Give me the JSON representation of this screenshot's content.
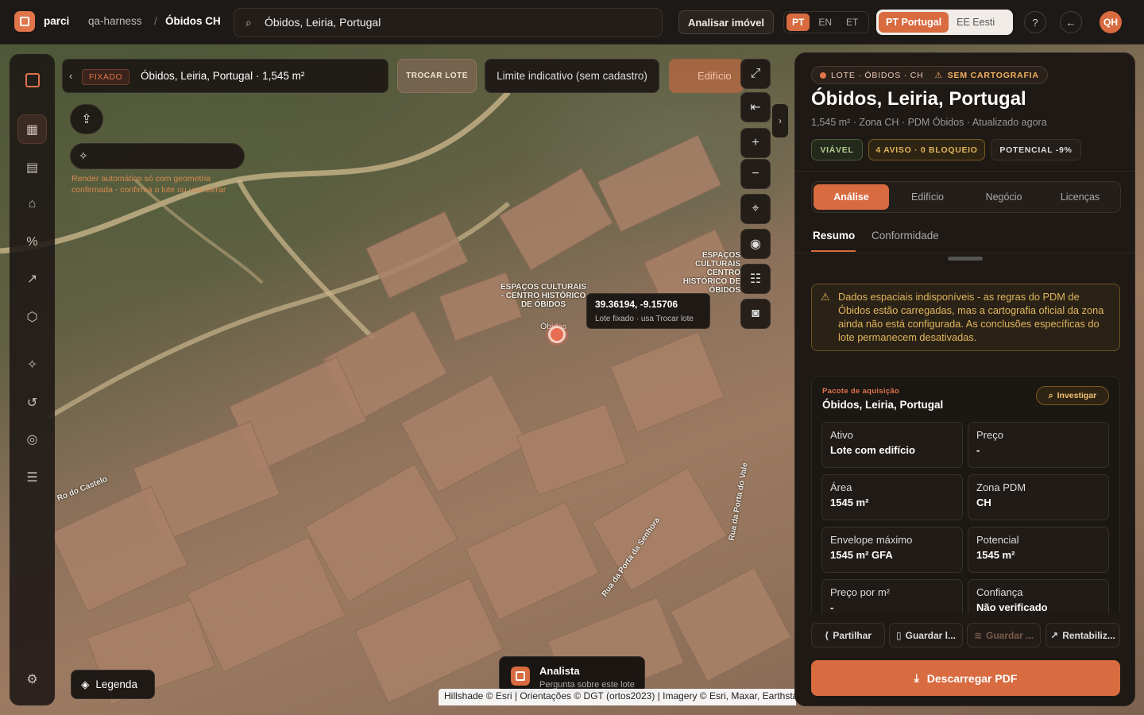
{
  "topbar": {
    "brand": "parci",
    "workspace": "qa-harness",
    "separator": "/",
    "project": "Óbidos CH",
    "search_value": "Óbidos, Leiria, Portugal",
    "analyze_button": "Analisar imóvel",
    "langs": [
      "PT",
      "EN",
      "ET"
    ],
    "active_lang": "PT",
    "regions": [
      "PT Portugal",
      "EE Eesti"
    ],
    "help": "?",
    "back": "←",
    "avatar": "QH"
  },
  "map": {
    "pin_badge": "FIXADO",
    "pin_title": "Óbidos, Leiria, Portugal · 1,545 m²",
    "trocar_lote": "TROCAR LOTE",
    "limite": "Limite indicativo (sem cadastro)",
    "edificio": "Edifício",
    "auto_render_hint": "Render automático só com geometria confirmada - confirma o lote ou usa Gerar",
    "coords": "39.36194, -9.15706",
    "coords_sub": "Lote fixado · usa Trocar lote",
    "legend": "Legenda",
    "analyst_title": "Analista",
    "analyst_sub": "Pergunta sobre este lote",
    "attribution": "Hillshade © Esri | Orientações © DGT (ortos2023) | Imagery © Esri, Maxar, Earthstar",
    "labels": [
      "ESPAÇOS CULTURAIS - CENTRO HISTÓRICO DE ÓBIDOS",
      "ESPAÇOS CULTURAIS CENTRO HISTÓRICO DE ÓBIDOS",
      "Rua da Porta do Vale",
      "Rua da Porta da Senhora",
      "Ro do Castelo",
      "Óbidos"
    ]
  },
  "panel": {
    "badge_lote": "LOTE · ÓBIDOS · CH",
    "badge_cart": "SEM CARTOGRAFIA",
    "title": "Óbidos, Leiria, Portugal",
    "subtitle": "1,545 m² · Zona CH · PDM Óbidos · Atualizado agora",
    "chips": [
      "VIÁVEL",
      "4 AVISO · 0 BLOQUEIO",
      "POTENCIAL -9%"
    ],
    "tabs": [
      "Análise",
      "Edifício",
      "Negócio",
      "Licenças"
    ],
    "subtabs": [
      "Resumo",
      "Conformidade"
    ],
    "warning": "Dados espaciais indisponíveis - as regras do PDM de Óbidos estão carregadas, mas a cartografia oficial da zona ainda não está configurada. As conclusões específicas do lote permanecem desativadas.",
    "pkg_label": "Pacote de aquisição",
    "pkg_title": "Óbidos, Leiria, Portugal",
    "investigate": "Investigar",
    "cells": [
      {
        "label": "Ativo",
        "value": "Lote com edifício"
      },
      {
        "label": "Preço",
        "value": "-"
      },
      {
        "label": "Área",
        "value": "1545 m²"
      },
      {
        "label": "Zona PDM",
        "value": "CH"
      },
      {
        "label": "Envelope máximo",
        "value": "1545 m² GFA"
      },
      {
        "label": "Potencial",
        "value": "1545 m²"
      },
      {
        "label": "Preço por m²",
        "value": "-"
      },
      {
        "label": "Confiança",
        "value": "Não verificado"
      }
    ],
    "actions": [
      "Partilhar",
      "Guardar l...",
      "Guardar ...",
      "Rentabiliz..."
    ],
    "pdf": "Descarregar PDF"
  },
  "colors": {
    "accent": "#d86b40",
    "warning": "#e0b55d",
    "viavel": "#b6c98f"
  }
}
